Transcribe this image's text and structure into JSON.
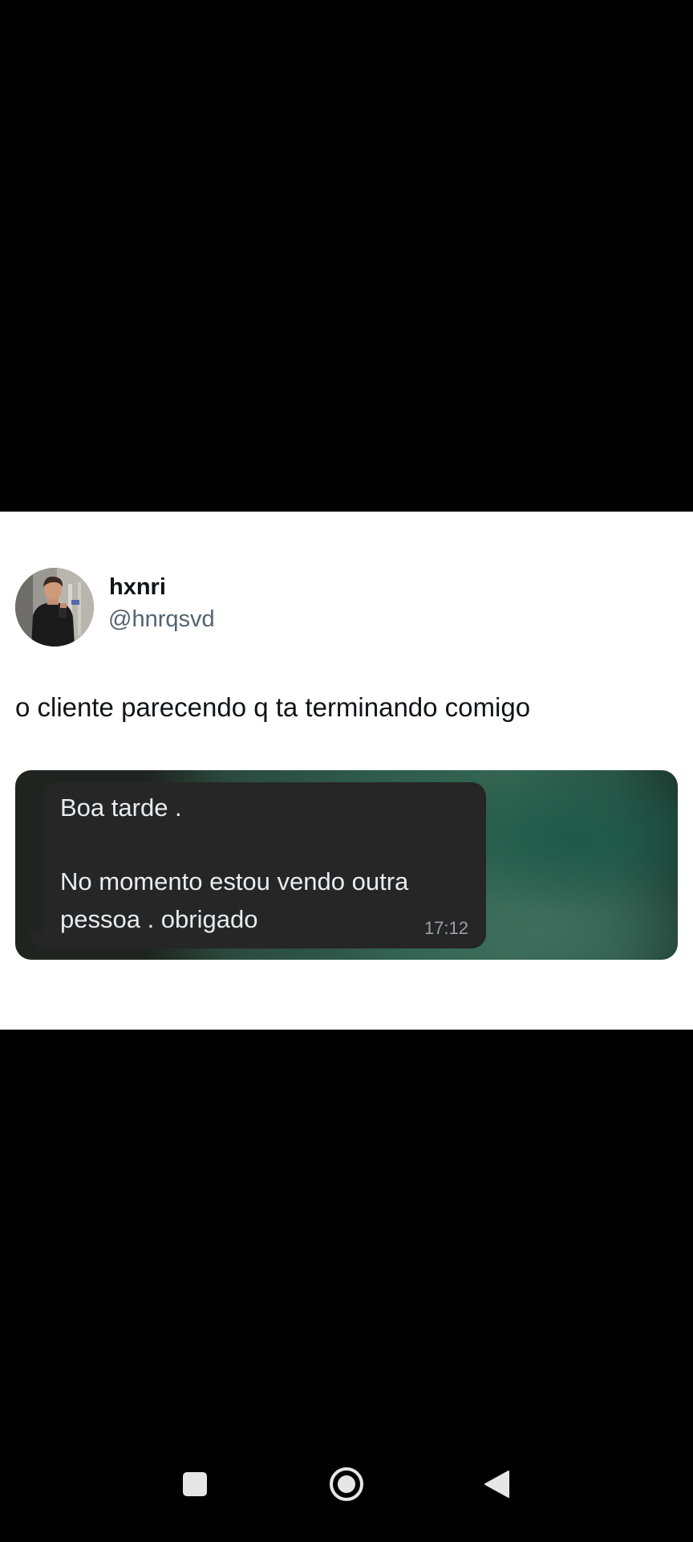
{
  "tweet": {
    "display_name": "hxnri",
    "handle": "@hnrqsvd",
    "text": "o cliente parecendo q ta terminando comigo"
  },
  "message": {
    "lines": [
      "Boa tarde  .",
      "No momento estou vendo outra",
      "pessoa . obrigado"
    ],
    "time": "17:12"
  },
  "colors": {
    "bubble": "#262626",
    "handle": "#536471",
    "nav_icons": "#e6e6e6"
  },
  "nav": {
    "icons": [
      "recents-icon",
      "home-icon",
      "back-icon"
    ]
  }
}
